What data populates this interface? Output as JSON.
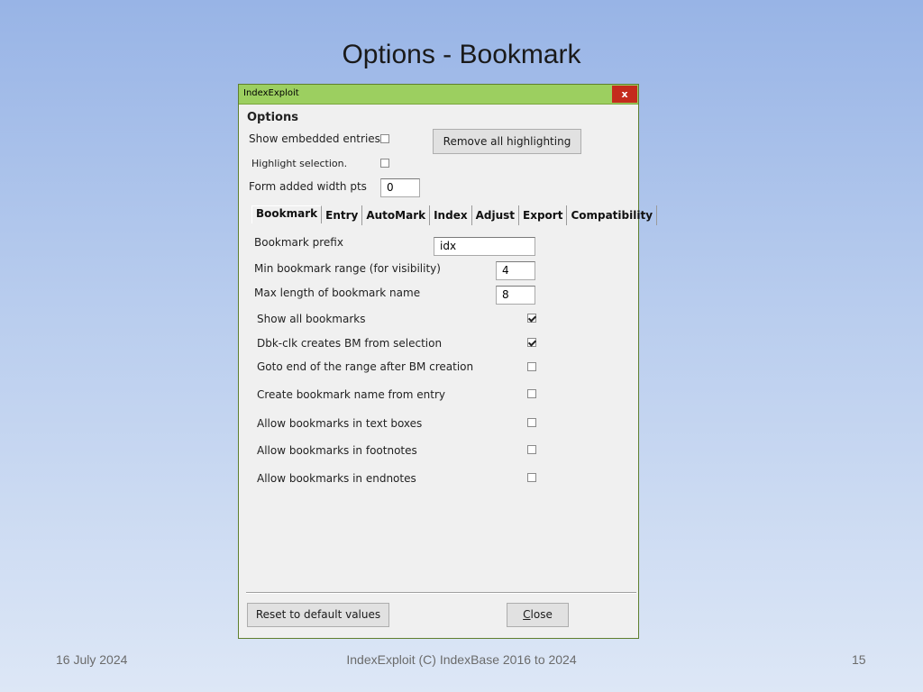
{
  "slide": {
    "title": "Options - Bookmark",
    "footer_date": "16 July 2024",
    "footer_center": "IndexExploit (C) IndexBase 2016 to 2024",
    "footer_page": "15"
  },
  "window": {
    "title": "IndexExploit",
    "close_glyph": "x"
  },
  "options": {
    "heading": "Options",
    "show_embedded_label": "Show embedded entries",
    "show_embedded_checked": false,
    "highlight_selection_label": "Highlight selection.",
    "highlight_selection_checked": false,
    "form_width_label": "Form added width pts",
    "form_width_value": "0",
    "remove_highlighting_button": "Remove all highlighting"
  },
  "tabs": [
    {
      "label": "Bookmark",
      "active": true
    },
    {
      "label": "Entry",
      "active": false
    },
    {
      "label": "AutoMark",
      "active": false
    },
    {
      "label": "Index",
      "active": false
    },
    {
      "label": "Adjust",
      "active": false
    },
    {
      "label": "Export",
      "active": false
    },
    {
      "label": "Compatibility",
      "active": false
    }
  ],
  "bookmark": {
    "prefix_label": "Bookmark prefix",
    "prefix_value": "idx",
    "min_range_label": "Min bookmark range (for visibility)",
    "min_range_value": "4",
    "max_length_label": "Max length of bookmark name",
    "max_length_value": "8",
    "checkboxes": [
      {
        "label": "Show all bookmarks",
        "checked": true
      },
      {
        "label": "Dbk-clk creates BM from selection",
        "checked": true
      },
      {
        "label": "Goto end of the range after BM creation",
        "checked": false
      },
      {
        "label": "Create bookmark name from entry",
        "checked": false
      },
      {
        "label": "Allow bookmarks in text boxes",
        "checked": false
      },
      {
        "label": "Allow bookmarks in footnotes",
        "checked": false
      },
      {
        "label": "Allow bookmarks in endnotes",
        "checked": false
      }
    ]
  },
  "footer_buttons": {
    "reset_label": "Reset to default values",
    "close_first_letter": "C",
    "close_rest": "lose"
  }
}
